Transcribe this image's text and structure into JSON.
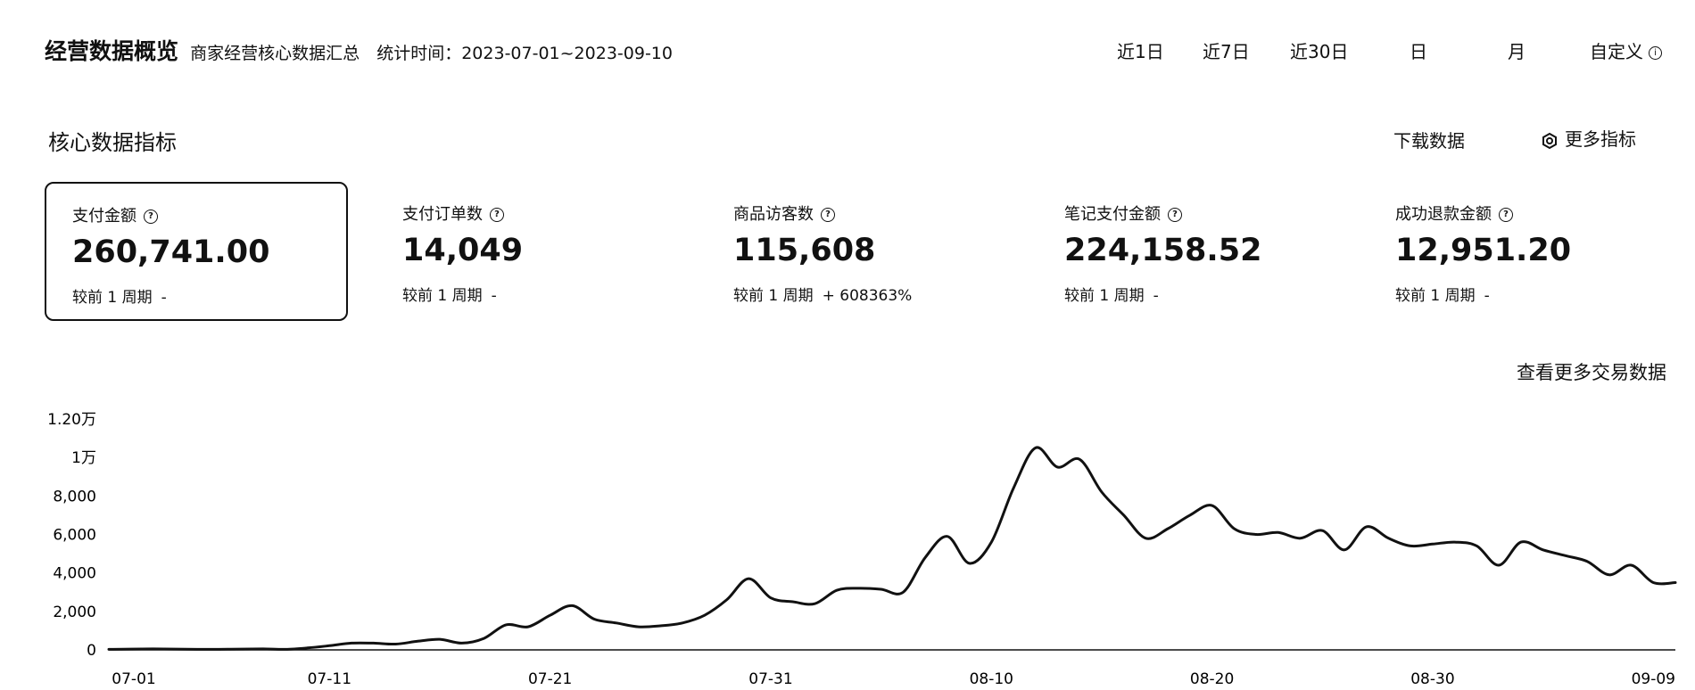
{
  "header": {
    "title": "经营数据概览",
    "subtitle": "商家经营核心数据汇总",
    "stat_time": "统计时间：2023-07-01~2023-09-10",
    "ranges": [
      "近1日",
      "近7日",
      "近30日",
      "日",
      "月",
      "自定义"
    ],
    "info_icon": "info-circle-icon"
  },
  "section": {
    "title": "核心数据指标",
    "download_label": "下载数据",
    "more_metrics_label": "更多指标",
    "more_metrics_icon": "eye-settings-icon"
  },
  "metrics": [
    {
      "label": "支付金额",
      "value": "260,741.00",
      "compare_label": "较前 1 周期",
      "compare_value": "-",
      "active": true
    },
    {
      "label": "支付订单数",
      "value": "14,049",
      "compare_label": "较前 1 周期",
      "compare_value": "-",
      "active": false
    },
    {
      "label": "商品访客数",
      "value": "115,608",
      "compare_label": "较前 1 周期",
      "compare_value": "+ 608363%",
      "active": false
    },
    {
      "label": "笔记支付金额",
      "value": "224,158.52",
      "compare_label": "较前 1 周期",
      "compare_value": "-",
      "active": false
    },
    {
      "label": "成功退款金额",
      "value": "12,951.20",
      "compare_label": "较前 1 周期",
      "compare_value": "-",
      "active": false
    }
  ],
  "more_trade_link": "查看更多交易数据",
  "chart_data": {
    "type": "line",
    "ylim": [
      0,
      12000
    ],
    "y_ticks": [
      {
        "value": 0,
        "label": "0"
      },
      {
        "value": 2000,
        "label": "2,000"
      },
      {
        "value": 4000,
        "label": "4,000"
      },
      {
        "value": 6000,
        "label": "6,000"
      },
      {
        "value": 8000,
        "label": "8,000"
      },
      {
        "value": 10000,
        "label": "1万"
      },
      {
        "value": 12000,
        "label": "1.20万"
      }
    ],
    "x_ticks": [
      "07-01",
      "07-11",
      "07-21",
      "07-31",
      "08-10",
      "08-20",
      "08-30",
      "09-09"
    ],
    "x": [
      "07-01",
      "07-02",
      "07-03",
      "07-04",
      "07-05",
      "07-06",
      "07-07",
      "07-08",
      "07-09",
      "07-10",
      "07-11",
      "07-12",
      "07-13",
      "07-14",
      "07-15",
      "07-16",
      "07-17",
      "07-18",
      "07-19",
      "07-20",
      "07-21",
      "07-22",
      "07-23",
      "07-24",
      "07-25",
      "07-26",
      "07-27",
      "07-28",
      "07-29",
      "07-30",
      "07-31",
      "08-01",
      "08-02",
      "08-03",
      "08-04",
      "08-05",
      "08-06",
      "08-07",
      "08-08",
      "08-09",
      "08-10",
      "08-11",
      "08-12",
      "08-13",
      "08-14",
      "08-15",
      "08-16",
      "08-17",
      "08-18",
      "08-19",
      "08-20",
      "08-21",
      "08-22",
      "08-23",
      "08-24",
      "08-25",
      "08-26",
      "08-27",
      "08-28",
      "08-29",
      "08-30",
      "08-31",
      "09-01",
      "09-02",
      "09-03",
      "09-04",
      "09-05",
      "09-06",
      "09-07",
      "09-08",
      "09-09",
      "09-10"
    ],
    "series": [
      {
        "color": "#111111",
        "values": [
          30,
          40,
          50,
          40,
          30,
          30,
          40,
          50,
          30,
          100,
          220,
          350,
          350,
          300,
          450,
          550,
          350,
          600,
          1300,
          1200,
          1800,
          2300,
          1600,
          1400,
          1200,
          1250,
          1400,
          1800,
          2600,
          3700,
          2700,
          2500,
          2400,
          3100,
          3200,
          3150,
          3000,
          4800,
          5900,
          4500,
          5600,
          8400,
          10500,
          9500,
          9900,
          8200,
          7000,
          5800,
          6300,
          7000,
          7500,
          6300,
          6000,
          6100,
          5800,
          6200,
          5200,
          6400,
          5800,
          5400,
          5500,
          5600,
          5400,
          4400,
          5600,
          5200,
          4900,
          4600,
          3900,
          4400,
          3500,
          3500
        ]
      }
    ]
  }
}
